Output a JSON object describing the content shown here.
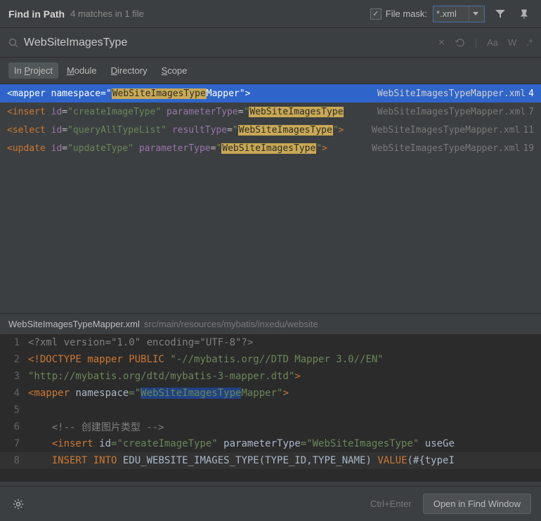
{
  "header": {
    "title": "Find in Path",
    "subtitle": "4 matches in 1 file",
    "filemask_checked": true,
    "filemask_label": "File mask:",
    "filemask_value": "*.xml"
  },
  "search": {
    "query": "WebSiteImagesType",
    "placeholder": ""
  },
  "tabs": {
    "project_prefix": "In ",
    "project_underline": "P",
    "project_rest": "roject",
    "module_underline": "M",
    "module_rest": "odule",
    "directory_underline": "D",
    "directory_rest": "irectory",
    "scope_underline": "S",
    "scope_rest": "cope"
  },
  "results": [
    {
      "pre": "<mapper namespace=\"",
      "hl": "WebSiteImagesType",
      "post": "Mapper\">",
      "file": "WebSiteImagesTypeMapper.xml",
      "line": "4",
      "selected": true
    },
    {
      "pre": "<insert id=\"createImageType\" parameterType=\"",
      "hl": "WebSiteImagesType",
      "post": "",
      "file": "WebSiteImagesTypeMapper.xml",
      "line": "7",
      "selected": false
    },
    {
      "pre": "<select id=\"queryAllTypeList\" resultType=\"",
      "hl": "WebSiteImagesType",
      "post": "\">",
      "file": "WebSiteImagesTypeMapper.xml",
      "line": "11",
      "selected": false
    },
    {
      "pre": "<update id=\"updateType\" parameterType=\"",
      "hl": "WebSiteImagesType",
      "post": "\">",
      "file": "WebSiteImagesTypeMapper.xml",
      "line": "19",
      "selected": false
    }
  ],
  "preview": {
    "file": "WebSiteImagesTypeMapper.xml",
    "path": "src/main/resources/mybatis/inxedu/website"
  },
  "editor": {
    "lines": {
      "l1": "<?xml version=\"1.0\" encoding=\"UTF-8\"?>",
      "l2a": "<!DOCTYPE mapper PUBLIC ",
      "l2b": "\"-//mybatis.org//DTD Mapper 3.0//EN\"",
      "l3": "\"http://mybatis.org/dtd/mybatis-3-mapper.dtd\"",
      "l3b": ">",
      "l4a": "<mapper ",
      "l4b": "namespace",
      "l4c": "=\"",
      "l4d": "WebSiteImagesType",
      "l4e": "Mapper\"",
      "l4f": ">",
      "l6": "<!-- 创建图片类型 -->",
      "l7a": "<insert ",
      "l7b": "id",
      "l7c": "=\"createImageType\" ",
      "l7d": "parameterType",
      "l7e": "=\"WebSiteImagesType\" ",
      "l7f": "useGe",
      "l8a": "INSERT INTO ",
      "l8b": "EDU_WEBSITE_IMAGES_TYPE(TYPE_ID,TYPE_NAME) ",
      "l8c": "VALUE",
      "l8d": "(#{typeI"
    }
  },
  "footer": {
    "hint": "Ctrl+Enter",
    "open": "Open in Find Window"
  }
}
